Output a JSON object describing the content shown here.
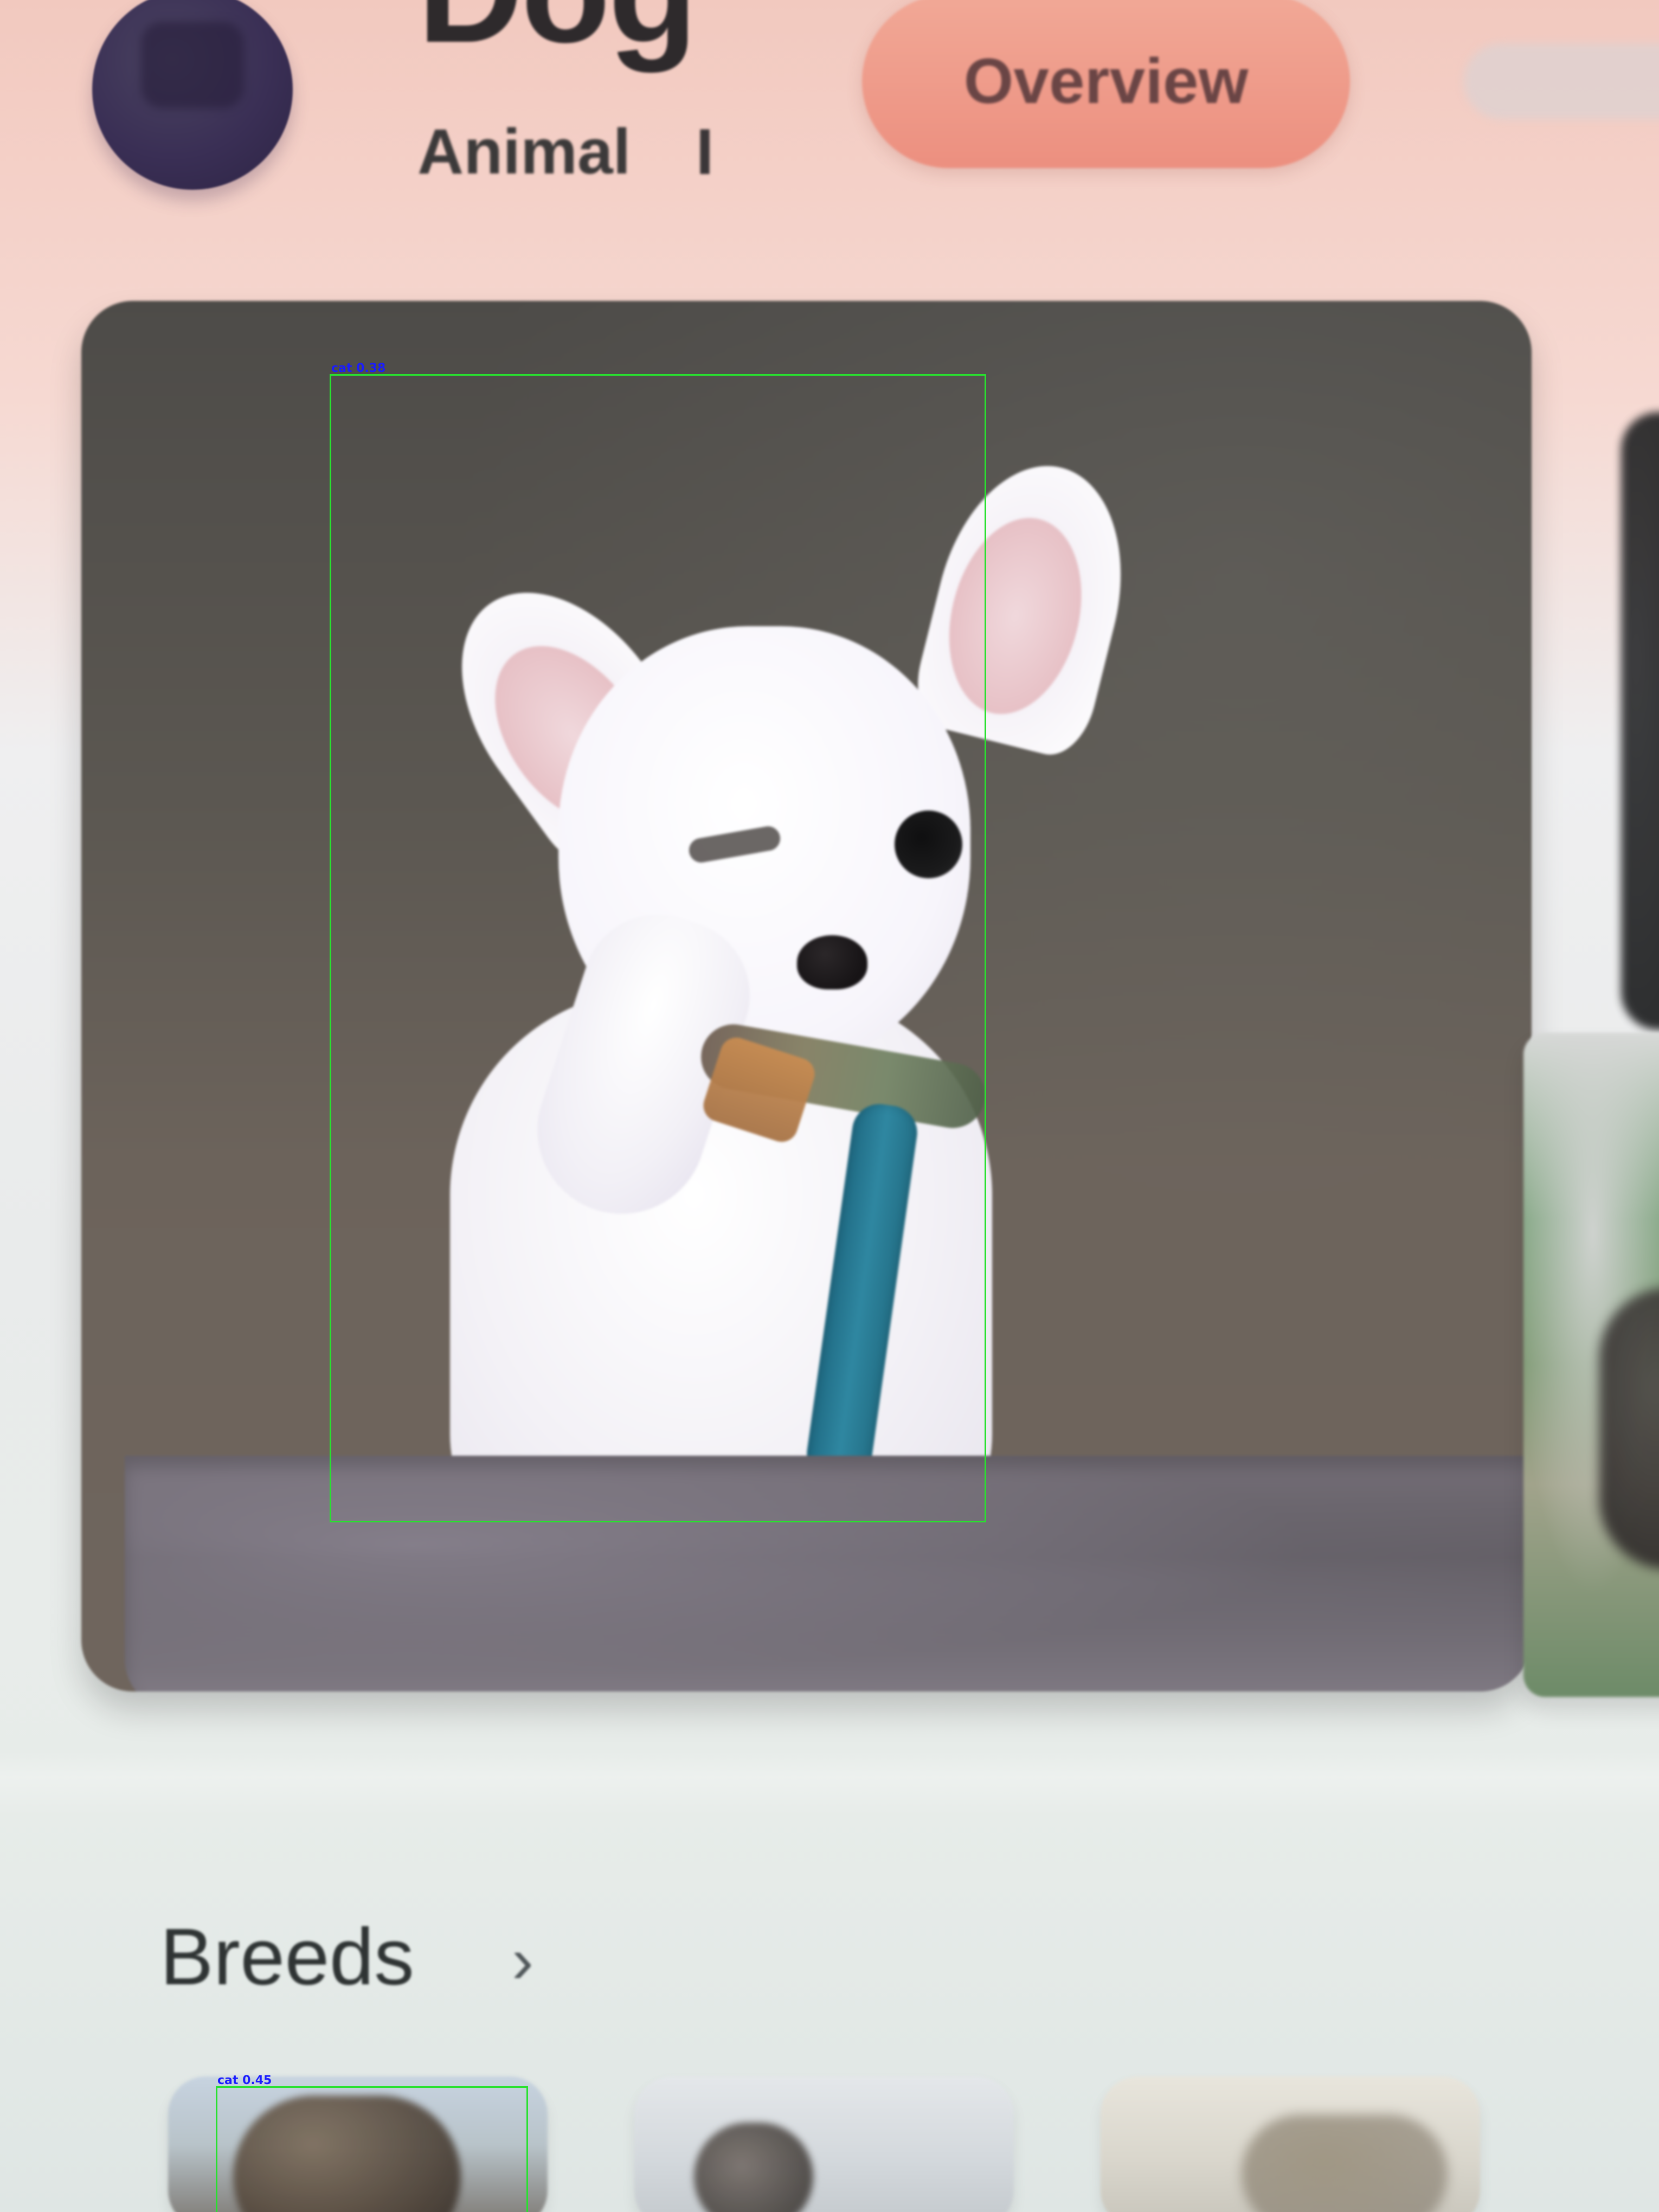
{
  "header": {
    "title": "Dog",
    "subtitle": "Animal",
    "info_icon_glyph": "I",
    "overview_tab_label": "Overview"
  },
  "breeds": {
    "title": "Breeds",
    "chevron_glyph": "›"
  },
  "detections": [
    {
      "label": "cat 0.38"
    },
    {
      "label": "cat 0.45"
    }
  ],
  "colors": {
    "detection_box": "#28e12f",
    "detection_label": "#1a1cff",
    "overview_tab": "#ec8f7f",
    "avatar": "#3a2f55"
  }
}
